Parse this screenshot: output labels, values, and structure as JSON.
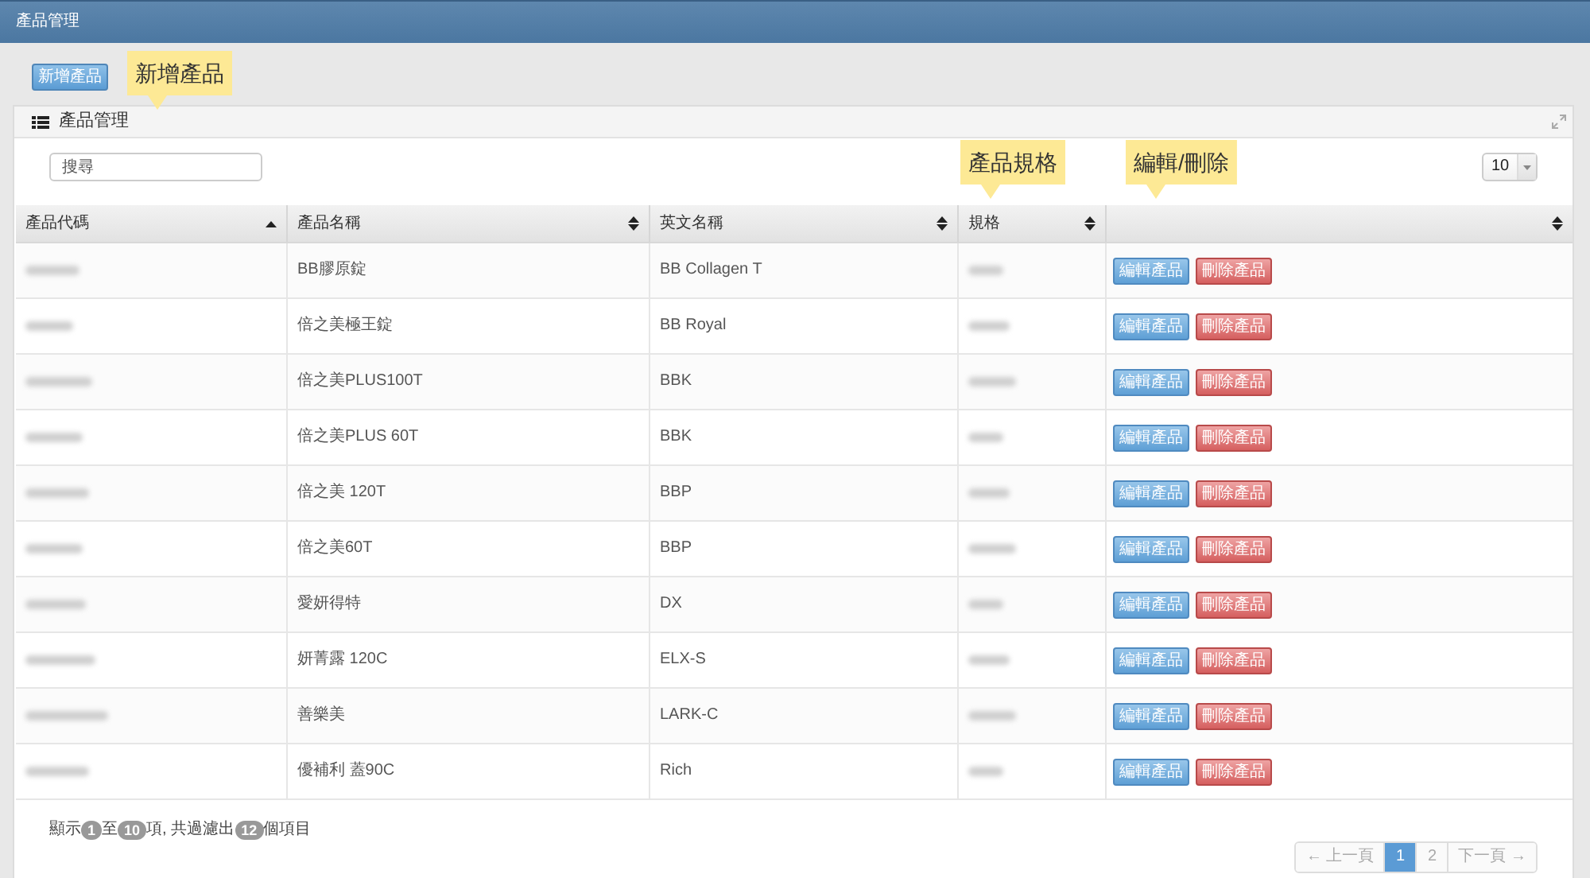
{
  "top_bar": {
    "title": "產品管理"
  },
  "add_button": {
    "label": "新增產品"
  },
  "callouts": [
    {
      "text": "新增產品"
    },
    {
      "text": "產品規格"
    },
    {
      "text": "編輯/刪除"
    }
  ],
  "panel": {
    "title": "產品管理"
  },
  "search": {
    "placeholder": "搜尋"
  },
  "page_size": {
    "value": "10"
  },
  "table": {
    "columns": [
      {
        "label": "產品代碼",
        "sorted": true
      },
      {
        "label": "產品名稱",
        "sorted": false
      },
      {
        "label": "英文名稱",
        "sorted": false
      },
      {
        "label": "規格",
        "sorted": false
      },
      {
        "sorted": false
      }
    ],
    "rows": [
      {
        "name": "BB膠原錠",
        "english_name": "BB Collagen T",
        "actions": [
          {
            "label": "編輯產品",
            "kind": "edit"
          },
          {
            "label": "刪除產品",
            "kind": "delete"
          }
        ]
      },
      {
        "name": "倍之美極王錠",
        "english_name": "BB Royal",
        "actions": [
          {
            "label": "編輯產品",
            "kind": "edit"
          },
          {
            "label": "刪除產品",
            "kind": "delete"
          }
        ]
      },
      {
        "name": "倍之美PLUS100T",
        "english_name": "BBK",
        "actions": [
          {
            "label": "編輯產品",
            "kind": "edit"
          },
          {
            "label": "刪除產品",
            "kind": "delete"
          }
        ]
      },
      {
        "name": "倍之美PLUS 60T",
        "english_name": "BBK",
        "actions": [
          {
            "label": "編輯產品",
            "kind": "edit"
          },
          {
            "label": "刪除產品",
            "kind": "delete"
          }
        ]
      },
      {
        "name": "倍之美 120T",
        "english_name": "BBP",
        "actions": [
          {
            "label": "編輯產品",
            "kind": "edit"
          },
          {
            "label": "刪除產品",
            "kind": "delete"
          }
        ]
      },
      {
        "name": "倍之美60T",
        "english_name": "BBP",
        "actions": [
          {
            "label": "編輯產品",
            "kind": "edit"
          },
          {
            "label": "刪除產品",
            "kind": "delete"
          }
        ]
      },
      {
        "name": "愛妍得特",
        "english_name": "DX",
        "actions": [
          {
            "label": "編輯產品",
            "kind": "edit"
          },
          {
            "label": "刪除產品",
            "kind": "delete"
          }
        ]
      },
      {
        "name": "妍菁露 120C",
        "english_name": "ELX-S",
        "actions": [
          {
            "label": "編輯產品",
            "kind": "edit"
          },
          {
            "label": "刪除產品",
            "kind": "delete"
          }
        ]
      },
      {
        "name": "善樂美",
        "english_name": "LARK-C",
        "actions": [
          {
            "label": "編輯產品",
            "kind": "edit"
          },
          {
            "label": "刪除產品",
            "kind": "delete"
          }
        ]
      },
      {
        "name": "優補利 蓋90C",
        "english_name": "Rich",
        "actions": [
          {
            "label": "編輯產品",
            "kind": "edit"
          },
          {
            "label": "刪除產品",
            "kind": "delete"
          }
        ]
      }
    ]
  },
  "footer": {
    "info": [
      {
        "text": "顯示",
        "kind": "text"
      },
      {
        "text": "1",
        "kind": "badge"
      },
      {
        "text": "至",
        "kind": "text"
      },
      {
        "text": "10",
        "kind": "badge"
      },
      {
        "text": "項, 共過濾出",
        "kind": "text"
      },
      {
        "text": "12",
        "kind": "badge"
      },
      {
        "text": "個項目",
        "kind": "text"
      }
    ],
    "pagination": [
      {
        "label": "← 上一頁",
        "selected": false
      },
      {
        "label": "1",
        "selected": true
      },
      {
        "label": "2",
        "selected": false
      },
      {
        "label": "下一頁 →",
        "selected": false
      }
    ]
  }
}
